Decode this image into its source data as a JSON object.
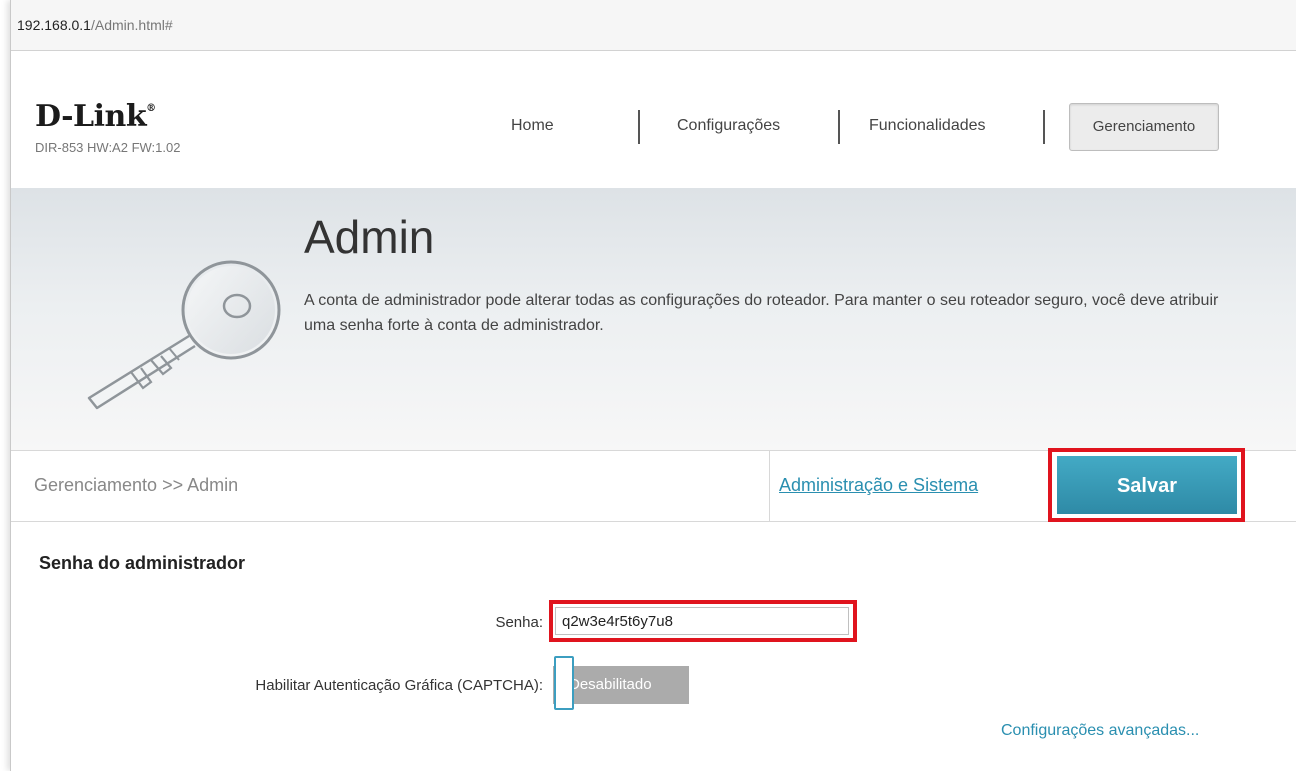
{
  "browser": {
    "url_host": "192.168.0.1",
    "url_path": "/Admin.html#"
  },
  "header": {
    "logo": "D-Link",
    "logo_mark": "®",
    "model": "DIR-853 HW:A2 FW:1.02",
    "nav": [
      "Home",
      "Configurações",
      "Funcionalidades",
      "Gerenciamento"
    ],
    "active_nav": "Gerenciamento"
  },
  "banner": {
    "title": "Admin",
    "description": "A conta de administrador pode alterar todas as configurações do roteador. Para manter o seu roteador seguro, você deve atribuir uma senha forte à conta de administrador.",
    "icon": "key-icon"
  },
  "crumbbar": {
    "breadcrumb": "Gerenciamento >> Admin",
    "link": "Administração e Sistema",
    "save_label": "Salvar"
  },
  "form": {
    "section_title": "Senha do administrador",
    "password_label": "Senha:",
    "password_value": "q2w3e4r5t6y7u8",
    "captcha_label": "Habilitar Autenticação Gráfica (CAPTCHA):",
    "captcha_state": "Desabilitado",
    "advanced_link": "Configurações avançadas..."
  },
  "colors": {
    "accent": "#2e8aa6",
    "highlight": "#e0141e",
    "toggle_off": "#ababab"
  }
}
